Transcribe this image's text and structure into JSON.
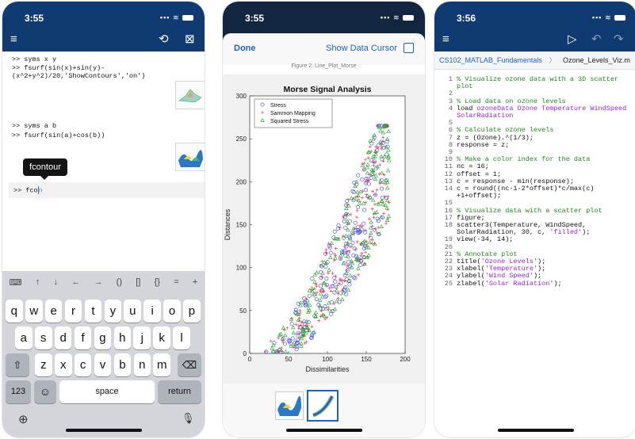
{
  "screen1": {
    "time": "3:55",
    "commands": [
      ">> syms x y",
      ">> fsurf(sin(x)+sin(y)-",
      "(x^2+y^2)/20,'ShowContours','on')",
      ">> syms a b",
      ">> fsurf(sin(a)+cos(b))"
    ],
    "tooltip": "fcontour",
    "input_prompt": ">> fco",
    "input_rest": "n",
    "symbols": [
      "↑",
      "↓",
      "←",
      "→",
      "()",
      "[]",
      "{}",
      "=",
      "+"
    ],
    "keys_row1": [
      "q",
      "w",
      "e",
      "r",
      "t",
      "y",
      "u",
      "i",
      "o",
      "p"
    ],
    "keys_row2": [
      "a",
      "s",
      "d",
      "f",
      "g",
      "h",
      "j",
      "k",
      "l"
    ],
    "keys_row3": [
      "z",
      "x",
      "c",
      "v",
      "b",
      "n",
      "m"
    ],
    "key_numbers": "123",
    "key_space": "space",
    "key_return": "return"
  },
  "screen2": {
    "time": "3:55",
    "done": "Done",
    "show_cursor": "Show Data Cursor",
    "figure_name": "Figure 2: Line_Plot_Morse"
  },
  "chart_data": {
    "type": "scatter",
    "title": "Morse Signal Analysis",
    "xlabel": "Dissimilarities",
    "ylabel": "Distances",
    "xlim": [
      0,
      200
    ],
    "ylim": [
      0,
      300
    ],
    "xticks": [
      0,
      50,
      100,
      150,
      200
    ],
    "yticks": [
      0,
      50,
      100,
      150,
      200,
      250,
      300
    ],
    "legend_position": "top-left",
    "series": [
      {
        "name": "Stress",
        "marker": "circle",
        "color": "#3b3bff"
      },
      {
        "name": "Sammon Mapping",
        "marker": "plus",
        "color": "#e0263a"
      },
      {
        "name": "Squared Stress",
        "marker": "triangle",
        "color": "#1aa51a"
      }
    ],
    "trend": "Distances increase from near 0 at dissimilarity ~20 to ~260 at ~175, spreading widely above 100"
  },
  "screen3": {
    "time": "3:56",
    "breadcrumb": [
      "CS102_MATLAB_Fundamentals",
      "Ozone_Levels_Viz.m"
    ],
    "code": [
      {
        "n": "1",
        "cls": "cm",
        "t": "% Visualize ozone data with a 3D scatter"
      },
      {
        "n": "",
        "cls": "cm",
        "t": "plot"
      },
      {
        "n": "2",
        "cls": "kw",
        "t": ""
      },
      {
        "n": "3",
        "cls": "cm",
        "t": "% Load data on ozone levels"
      },
      {
        "n": "4",
        "cls": "kw",
        "t": "load ",
        "extra": "ozoneData Ozone Temperature WindSpeed",
        "extracls": "str"
      },
      {
        "n": "",
        "cls": "str",
        "t": "SolarRadiation"
      },
      {
        "n": "5",
        "cls": "kw",
        "t": ""
      },
      {
        "n": "6",
        "cls": "cm",
        "t": "% Calculate ozone levels"
      },
      {
        "n": "7",
        "cls": "kw",
        "t": "z = (Ozone).^(1/3);"
      },
      {
        "n": "8",
        "cls": "kw",
        "t": "response = z;"
      },
      {
        "n": "9",
        "cls": "kw",
        "t": ""
      },
      {
        "n": "10",
        "cls": "cm",
        "t": "% Make a color index for the data"
      },
      {
        "n": "11",
        "cls": "kw",
        "t": "nc = 16;"
      },
      {
        "n": "12",
        "cls": "kw",
        "t": "offset = 1;"
      },
      {
        "n": "13",
        "cls": "kw",
        "t": "c = response - min(response);"
      },
      {
        "n": "14",
        "cls": "kw",
        "t": "c = round((nc-1-2*offset)*c/max(c)"
      },
      {
        "n": "",
        "cls": "kw",
        "t": "+1+offset);"
      },
      {
        "n": "15",
        "cls": "kw",
        "t": ""
      },
      {
        "n": "16",
        "cls": "cm",
        "t": "% Visualize data with a scatter plot"
      },
      {
        "n": "17",
        "cls": "kw",
        "t": "figure;"
      },
      {
        "n": "18",
        "cls": "kw",
        "t": "scatter3(Temperature, WindSpeed,"
      },
      {
        "n": "",
        "cls": "kw",
        "t": "SolarRadiation, 30, c, ",
        "extra": "'filled'",
        "extracls": "str",
        "tail": ");"
      },
      {
        "n": "19",
        "cls": "kw",
        "t": "view(-34, 14);"
      },
      {
        "n": "20",
        "cls": "kw",
        "t": ""
      },
      {
        "n": "21",
        "cls": "cm",
        "t": "% Annotate plot"
      },
      {
        "n": "22",
        "cls": "kw",
        "t": "title(",
        "extra": "'Ozone Levels'",
        "extracls": "str",
        "tail": ");"
      },
      {
        "n": "23",
        "cls": "kw",
        "t": "xlabel(",
        "extra": "'Temperature'",
        "extracls": "str",
        "tail": ");"
      },
      {
        "n": "24",
        "cls": "kw",
        "t": "ylabel(",
        "extra": "'Wind Speed'",
        "extracls": "str",
        "tail": ");"
      },
      {
        "n": "25",
        "cls": "kw",
        "t": "zlabel(",
        "extra": "'Solar Radiation'",
        "extracls": "str",
        "tail": ");"
      }
    ]
  },
  "colors": {
    "navbar": "#0f3b72",
    "link": "#1c62c4",
    "keyboard": "#d3d5da"
  }
}
